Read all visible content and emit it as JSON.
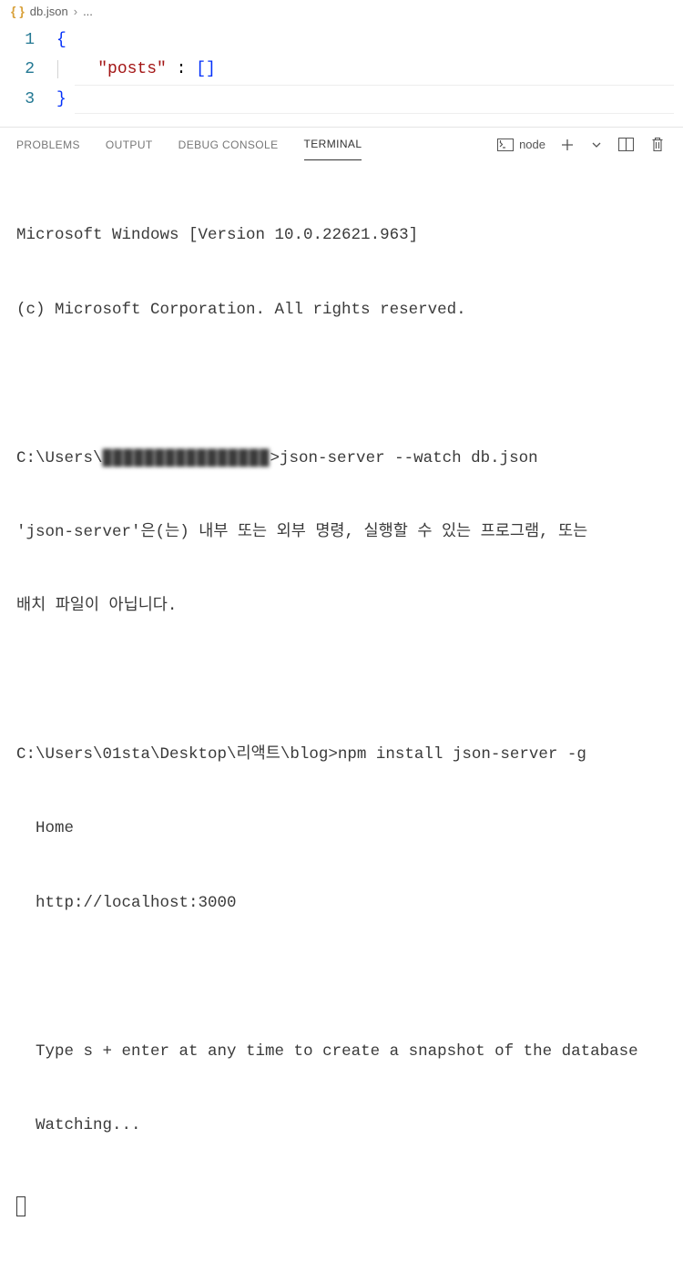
{
  "breadcrumb": {
    "file": "db.json",
    "rest": "..."
  },
  "editor": {
    "lines": {
      "n1": "1",
      "n2": "2",
      "n3": "3",
      "brace_open": "{",
      "key_posts": "\"posts\"",
      "colon": " : ",
      "empty_arr": "[]",
      "brace_close": "}"
    }
  },
  "panel": {
    "tabs": {
      "problems": "PROBLEMS",
      "output": "OUTPUT",
      "debug": "DEBUG CONSOLE",
      "terminal": "TERMINAL"
    },
    "shell_label": "node"
  },
  "terminal": {
    "l1": "Microsoft Windows [Version 10.0.22621.963]",
    "l2": "(c) Microsoft Corporation. All rights reserved.",
    "blank": " ",
    "l3_pre": "C:\\Users\\",
    "l3_censored": "████████████████",
    "l3_post": ">json-server --watch db.json",
    "l4": "'json-server'은(는) 내부 또는 외부 명령, 실행할 수 있는 프로그램, 또는",
    "l5": "배치 파일이 아닙니다.",
    "l6": "C:\\Users\\01sta\\Desktop\\리액트\\blog>npm install json-server -g",
    "l7": "  Home",
    "l8": "  http://localhost:3000",
    "l9": "  Type s + enter at any time to create a snapshot of the database",
    "l10": "  Watching..."
  }
}
